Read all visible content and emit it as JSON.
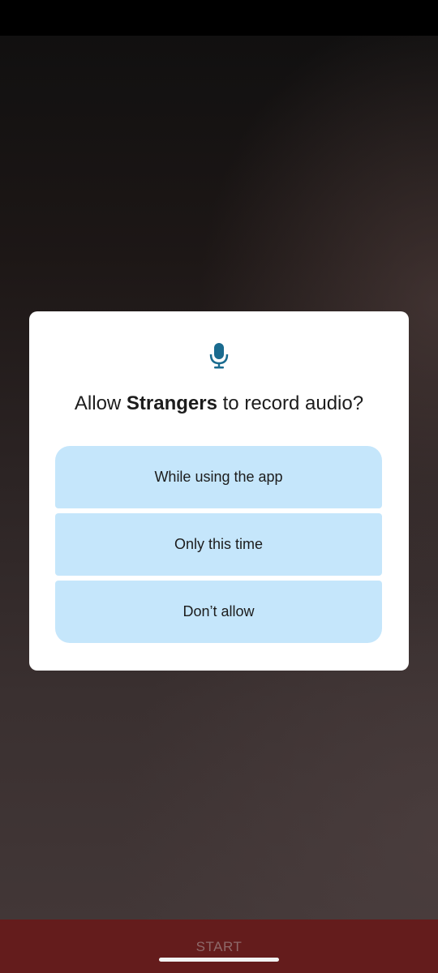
{
  "dialog": {
    "title_prefix": "Allow ",
    "app_name": "Strangers",
    "title_suffix": " to record audio?",
    "icon": "microphone-icon",
    "options": [
      {
        "label": "While using the app"
      },
      {
        "label": "Only this time"
      },
      {
        "label": "Don’t allow"
      }
    ]
  },
  "bottom_bar": {
    "start_label": "START"
  },
  "colors": {
    "option_bg": "#c5e6fb",
    "icon_color": "#1a6b8f",
    "bottom_bar_bg": "#641c1c",
    "dialog_bg": "#ffffff"
  }
}
